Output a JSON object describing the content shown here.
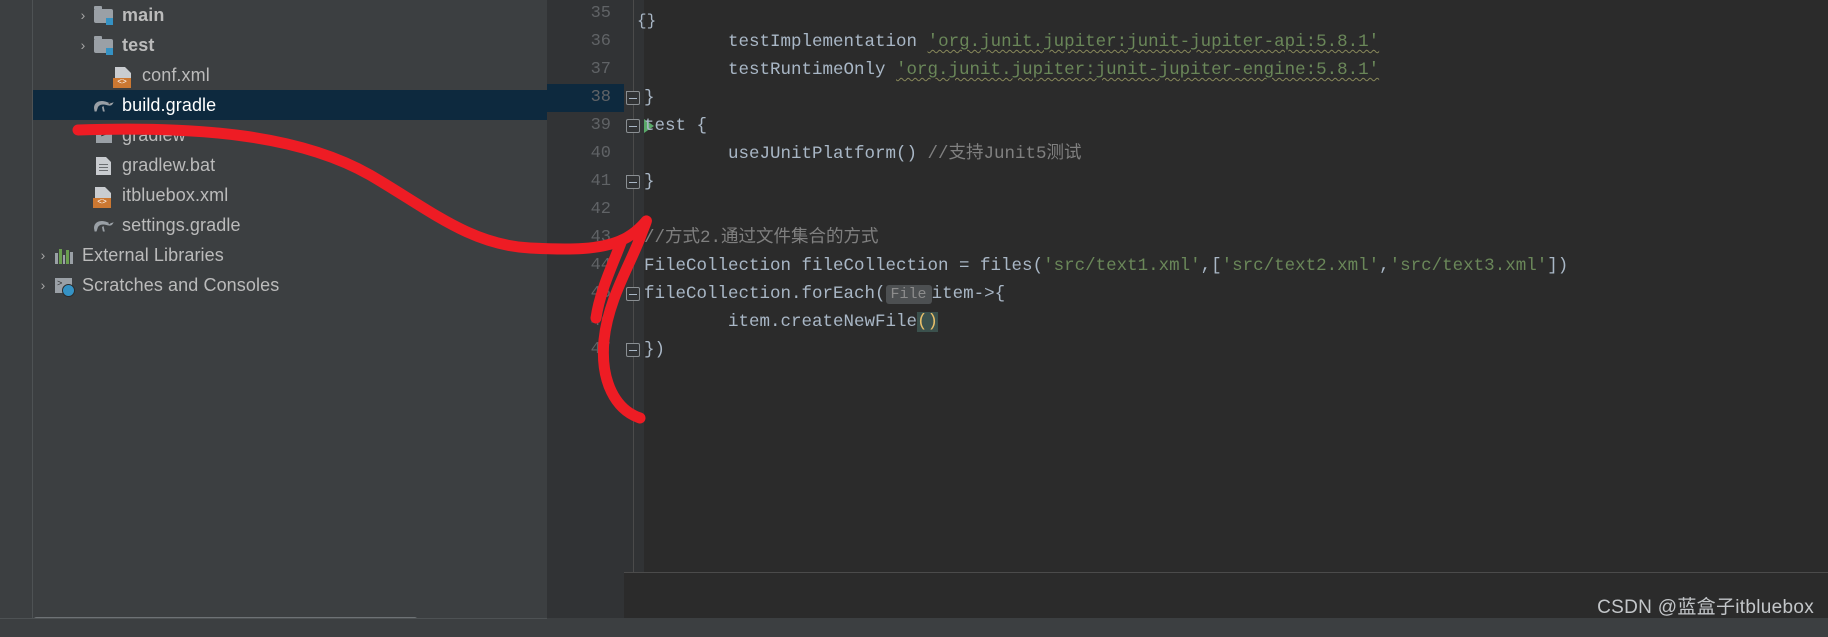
{
  "app": {
    "theme_bg": "#3c3f41",
    "editor_bg": "#2b2b2b",
    "gutter_bg": "#313335",
    "selection_color": "#0d293e",
    "annotation_color": "#ee1c24"
  },
  "sidebar": {
    "items": [
      {
        "label": "main",
        "icon": "folder-icon",
        "arrow": "›",
        "indent": 3,
        "bold": true,
        "selected": false
      },
      {
        "label": "test",
        "icon": "folder-icon",
        "arrow": "›",
        "indent": 3,
        "bold": true,
        "selected": false
      },
      {
        "label": "conf.xml",
        "icon": "xml-file-icon",
        "arrow": "",
        "indent": 4,
        "bold": false,
        "selected": false
      },
      {
        "label": "build.gradle",
        "icon": "gradle-file-icon",
        "arrow": "",
        "indent": 3,
        "bold": false,
        "selected": true
      },
      {
        "label": "gradlew",
        "icon": "script-file-icon",
        "arrow": "",
        "indent": 3,
        "bold": false,
        "selected": false
      },
      {
        "label": "gradlew.bat",
        "icon": "text-file-icon",
        "arrow": "",
        "indent": 3,
        "bold": false,
        "selected": false
      },
      {
        "label": "itbluebox.xml",
        "icon": "xml-file-icon",
        "arrow": "",
        "indent": 3,
        "bold": false,
        "selected": false
      },
      {
        "label": "settings.gradle",
        "icon": "gradle-file-icon",
        "arrow": "",
        "indent": 3,
        "bold": false,
        "selected": false
      },
      {
        "label": "External Libraries",
        "icon": "library-icon",
        "arrow": "›",
        "indent": 1,
        "bold": false,
        "selected": false
      },
      {
        "label": "Scratches and Consoles",
        "icon": "scratches-icon",
        "arrow": "›",
        "indent": 1,
        "bold": false,
        "selected": false
      }
    ]
  },
  "editor": {
    "first_line_number": 35,
    "lines": [
      {
        "num": 35,
        "fold": null,
        "run": false,
        "tokens": []
      },
      {
        "num": 36,
        "fold": null,
        "run": false,
        "tokens": [
          {
            "t": "        ",
            "c": "plain"
          },
          {
            "t": "testImplementation ",
            "c": "plain"
          },
          {
            "t": "'org.junit.jupiter:junit-jupiter-api:5.8.1'",
            "c": "str squiggle"
          }
        ]
      },
      {
        "num": 37,
        "fold": null,
        "run": false,
        "tokens": [
          {
            "t": "        ",
            "c": "plain"
          },
          {
            "t": "testRuntimeOnly ",
            "c": "plain"
          },
          {
            "t": "'org.junit.jupiter:junit-jupiter-engine:5.8.1'",
            "c": "str squiggle"
          }
        ]
      },
      {
        "num": 38,
        "fold": "end",
        "run": false,
        "tokens": [
          {
            "t": "}",
            "c": "plain"
          }
        ]
      },
      {
        "num": 39,
        "fold": "start",
        "run": true,
        "tokens": [
          {
            "t": "test {",
            "c": "plain"
          }
        ]
      },
      {
        "num": 40,
        "fold": null,
        "run": false,
        "tokens": [
          {
            "t": "        useJUnitPlatform() ",
            "c": "plain"
          },
          {
            "t": "//支持Junit5测试",
            "c": "cmt"
          }
        ]
      },
      {
        "num": 41,
        "fold": "end",
        "run": false,
        "tokens": [
          {
            "t": "}",
            "c": "plain"
          }
        ]
      },
      {
        "num": 42,
        "fold": null,
        "run": false,
        "tokens": []
      },
      {
        "num": 43,
        "fold": null,
        "run": false,
        "tokens": [
          {
            "t": "//方式2.通过文件集合的方式",
            "c": "cmt"
          }
        ]
      },
      {
        "num": 44,
        "fold": null,
        "run": false,
        "tokens": [
          {
            "t": "FileCollection fileCollection = files(",
            "c": "plain"
          },
          {
            "t": "'src/text1.xml'",
            "c": "str"
          },
          {
            "t": ",[",
            "c": "plain"
          },
          {
            "t": "'src/text2.xml'",
            "c": "str"
          },
          {
            "t": ",",
            "c": "plain"
          },
          {
            "t": "'src/text3.xml'",
            "c": "str"
          },
          {
            "t": "])",
            "c": "plain"
          }
        ]
      },
      {
        "num": 45,
        "fold": "start",
        "run": false,
        "tokens": [
          {
            "t": "fileCollection.forEach(",
            "c": "plain"
          },
          {
            "t": "File",
            "c": "hint"
          },
          {
            "t": "item->{",
            "c": "plain"
          }
        ]
      },
      {
        "num": 46,
        "fold": null,
        "run": false,
        "tokens": [
          {
            "t": "        item.createNewFile",
            "c": "plain"
          },
          {
            "t": "()",
            "c": "brace-y"
          }
        ]
      },
      {
        "num": 47,
        "fold": "end",
        "run": false,
        "tokens": [
          {
            "t": "})",
            "c": "plain"
          }
        ]
      }
    ],
    "breadcrumb": "{}"
  },
  "watermark": {
    "text": "CSDN @蓝盒子itbluebox"
  }
}
